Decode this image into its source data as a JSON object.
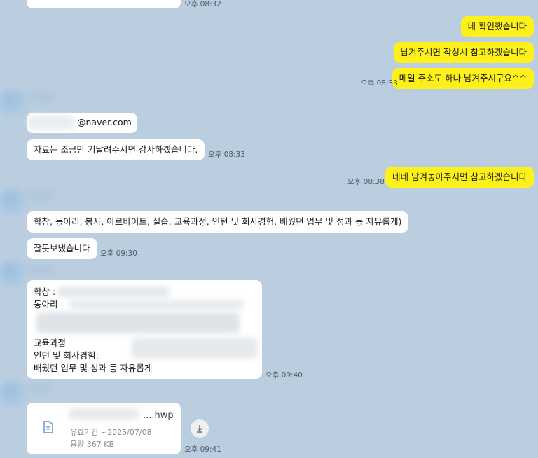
{
  "messages": [
    {
      "id": "m0_time",
      "text": "오후 08:32"
    },
    {
      "id": "m1",
      "text": "네 확인했습니다"
    },
    {
      "id": "m2",
      "text": "남겨주시면 작성시 참고하겠습니다"
    },
    {
      "id": "m3",
      "text": "메일 주소도 하나 남겨주시구요^^",
      "time": "오후 08:33"
    },
    {
      "id": "m4",
      "text": "@naver.com"
    },
    {
      "id": "m5",
      "text": "자료는 조금만 기달려주시면 감사하겠습니다.",
      "time": "오후 08:33"
    },
    {
      "id": "m6",
      "text": "네네 남겨놓아주시면 참고하겠습니다",
      "time": "오후 08:38"
    },
    {
      "id": "m7",
      "text": "학창, 동아리, 봉사, 아르바이트, 실습, 교육과정, 인턴 및 회사경험, 배웠던 업무 및 성과 등 자유롭게)"
    },
    {
      "id": "m8",
      "text": "잘못보냈습니다",
      "time": "오후 09:30"
    },
    {
      "id": "m9",
      "lines": [
        "학창 :",
        "동아리",
        "",
        "",
        "",
        "교육과정",
        "인턴 및 회사경험:",
        "배웠던 업무 및 성과 등 자유롭게"
      ],
      "time": "오후 09:40"
    }
  ],
  "file": {
    "name": "....hwp",
    "expiry": "유효기간 ~2025/07/08",
    "size": "용량 367 KB",
    "time": "오후 09:41",
    "icon": "document-icon",
    "download_icon": "download-icon"
  },
  "colors": {
    "background": "#bacee0",
    "mine": "#fef01b",
    "theirs": "#ffffff"
  }
}
